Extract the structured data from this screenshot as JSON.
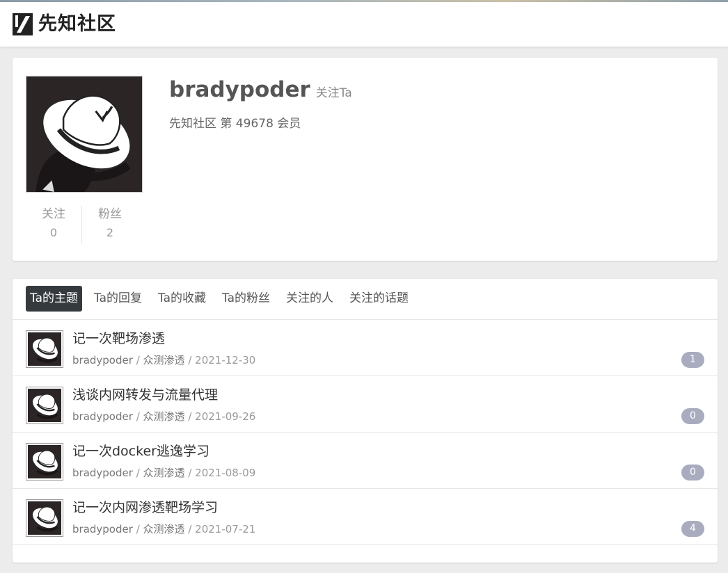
{
  "site": {
    "brand": "先知社区"
  },
  "profile": {
    "username": "bradypoder",
    "follow_label": "关注Ta",
    "member_line": "先知社区 第 49678 会员",
    "stats": {
      "following_label": "关注",
      "following_count": "0",
      "followers_label": "粉丝",
      "followers_count": "2"
    }
  },
  "tabs": [
    {
      "label": "Ta的主题",
      "active": true
    },
    {
      "label": "Ta的回复",
      "active": false
    },
    {
      "label": "Ta的收藏",
      "active": false
    },
    {
      "label": "Ta的粉丝",
      "active": false
    },
    {
      "label": "关注的人",
      "active": false
    },
    {
      "label": "关注的话题",
      "active": false
    }
  ],
  "topics": [
    {
      "title": "记一次靶场渗透",
      "author": "bradypoder",
      "category": "众测渗透",
      "date": "2021-12-30",
      "replies": "1"
    },
    {
      "title": "浅谈内网转发与流量代理",
      "author": "bradypoder",
      "category": "众测渗透",
      "date": "2021-09-26",
      "replies": "0"
    },
    {
      "title": "记一次docker逃逸学习",
      "author": "bradypoder",
      "category": "众测渗透",
      "date": "2021-08-09",
      "replies": "0"
    },
    {
      "title": "记一次内网渗透靶场学习",
      "author": "bradypoder",
      "category": "众测渗透",
      "date": "2021-07-21",
      "replies": "4"
    }
  ],
  "separator": "/",
  "colors": {
    "active_tab": "#353a3f",
    "badge": "#a8acbe",
    "page_bg": "#ececec"
  },
  "icons": {
    "brand": "xianzhi-logo-icon",
    "avatar": "white-fedora-avatar"
  }
}
